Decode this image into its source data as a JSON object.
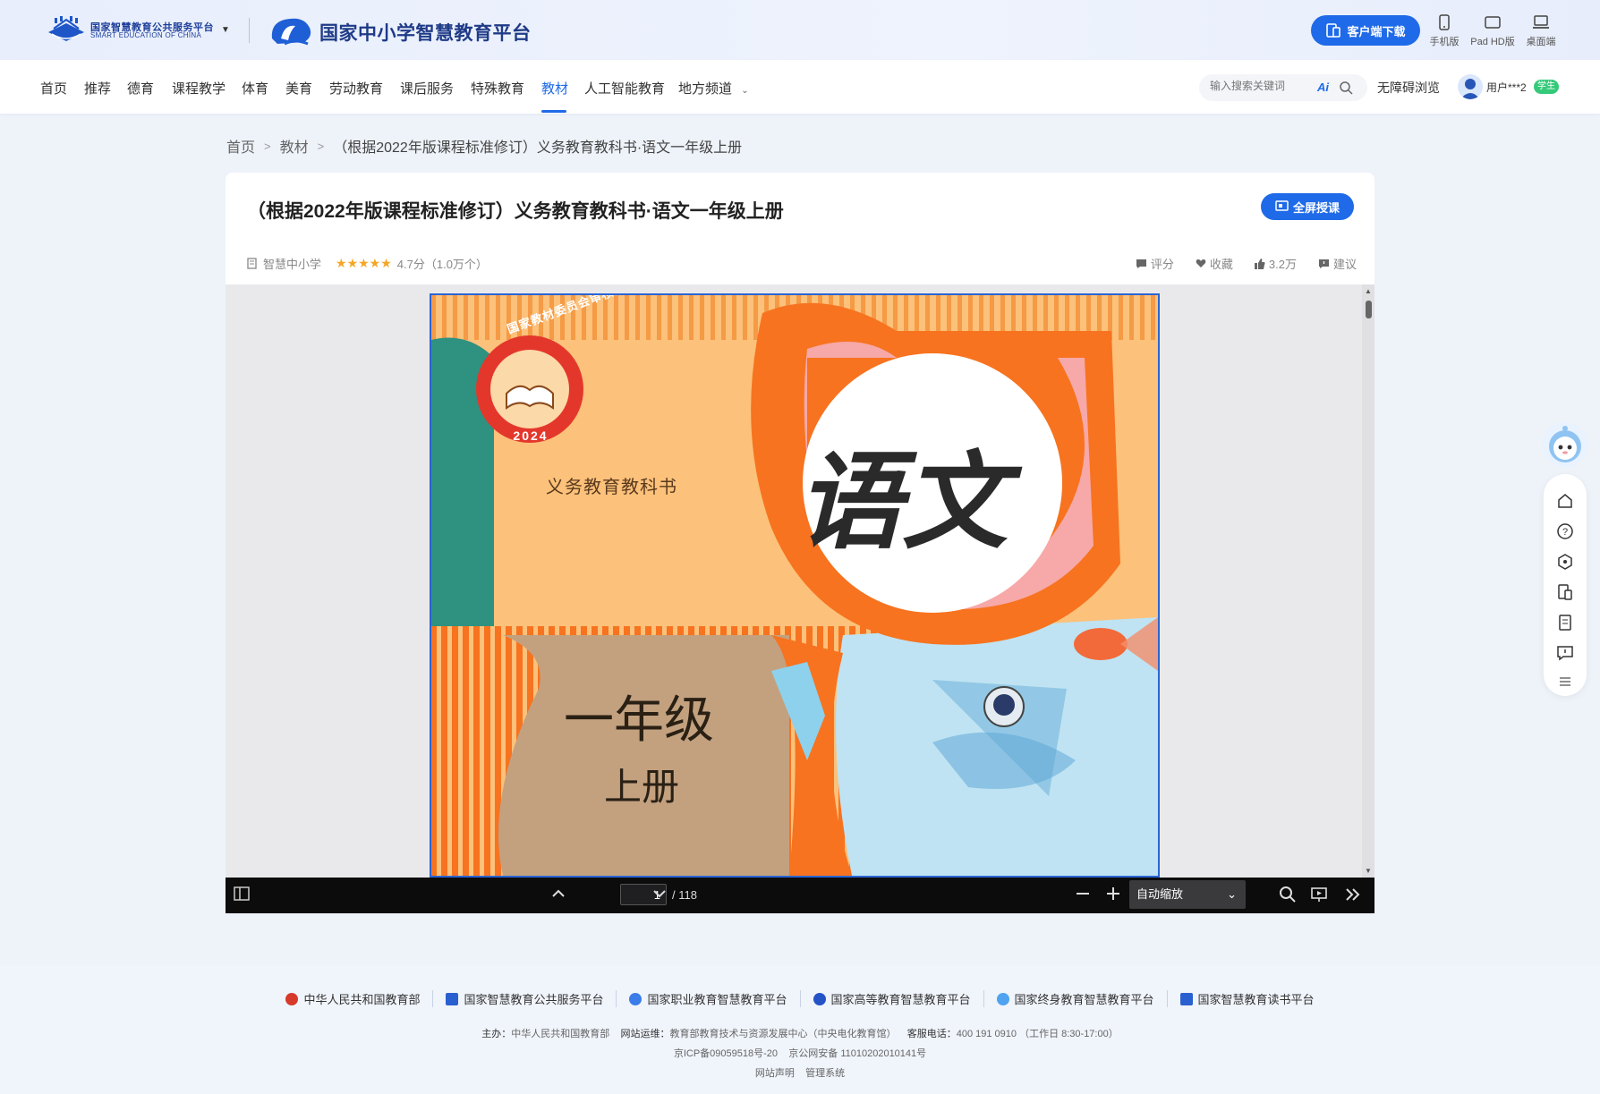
{
  "brand": {
    "platform_name_cn": "国家智慧教育公共服务平台",
    "platform_name_en": "SMART EDUCATION OF CHINA",
    "site_name": "国家中小学智慧教育平台",
    "download_button": "客户端下载",
    "devices": [
      {
        "label": "手机版",
        "icon": "phone-icon"
      },
      {
        "label": "Pad HD版",
        "icon": "tablet-icon"
      },
      {
        "label": "桌面端",
        "icon": "laptop-icon"
      }
    ]
  },
  "nav": {
    "items": [
      "首页",
      "推荐",
      "德育",
      "课程教学",
      "体育",
      "美育",
      "劳动教育",
      "课后服务",
      "特殊教育",
      "教材",
      "人工智能教育",
      "地方频道"
    ],
    "active": "教材",
    "search_placeholder": "输入搜索关键词",
    "ai_label": "Ai",
    "accessibility": "无障碍浏览",
    "user_name": "用户***2",
    "user_badge": "学生"
  },
  "breadcrumb": {
    "home": "首页",
    "section": "教材",
    "sep": ">",
    "current": "（根据2022年版课程标准修订）义务教育教科书·语文一年级上册"
  },
  "book": {
    "title": "（根据2022年版课程标准修订）义务教育教科书·语文一年级上册",
    "fullscreen_button": "全屏授课",
    "source": "智慧中小学",
    "rating": 4.7,
    "rating_text": "4.7分（1.0万个）",
    "actions": {
      "review": "评分",
      "favorite": "收藏",
      "likes": "3.2万",
      "suggest": "建议"
    }
  },
  "cover": {
    "seal_text": "国家教材委员会审核通过",
    "seal_year": "2024",
    "series": "义务教育教科书",
    "subject": "语文",
    "grade": "一年级",
    "volume": "上册"
  },
  "viewer": {
    "current_page": "1",
    "total_pages": "/ 118",
    "zoom": "自动缩放"
  },
  "footer": {
    "links": [
      "中华人民共和国教育部",
      "国家智慧教育公共服务平台",
      "国家职业教育智慧教育平台",
      "国家高等教育智慧教育平台",
      "国家终身教育智慧教育平台",
      "国家智慧教育读书平台"
    ],
    "host_label": "主办：",
    "host": "中华人民共和国教育部",
    "ops_label": "网站运维：",
    "ops": "教育部教育技术与资源发展中心（中央电化教育馆）",
    "hotline_label": "客服电话：",
    "hotline": "400 191 0910 （工作日 8:30-17:00）",
    "icp": "京ICP备09059518号-20",
    "police": "京公网安备 11010202010141号",
    "statement": "网站声明",
    "admin": "管理系统"
  },
  "colors": {
    "primary": "#1f6ae8",
    "cover_orange": "#f7731f",
    "cover_peach": "#fcc17a",
    "cover_teal": "#2f9180",
    "cover_tan": "#c3a17f",
    "star": "#f5a623",
    "badge_green": "#35c97a"
  }
}
